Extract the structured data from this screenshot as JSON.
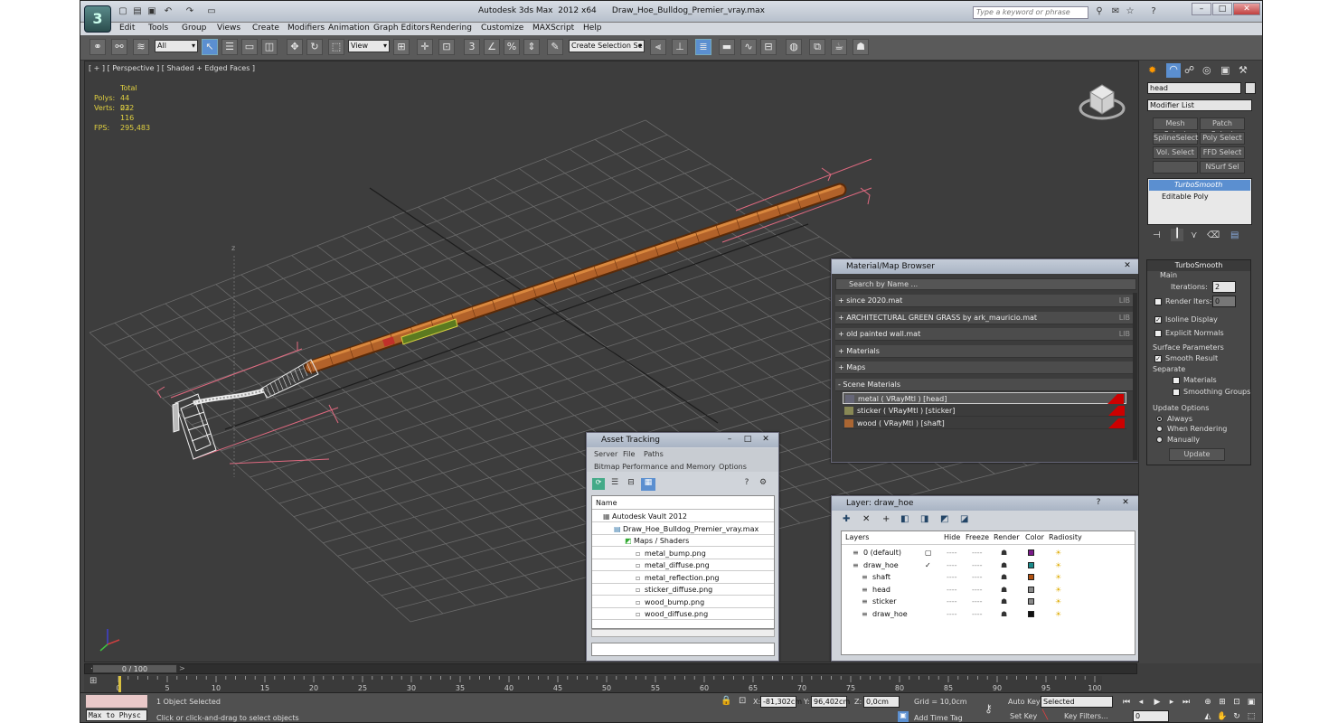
{
  "window": {
    "title": "Autodesk 3ds Max  2012 x64      Draw_Hoe_Bulldog_Premier_vray.max",
    "search_placeholder": "Type a keyword or phrase",
    "minimize": "–",
    "maximize": "□",
    "close": "✕"
  },
  "menu": [
    "Edit",
    "Tools",
    "Group",
    "Views",
    "Create",
    "Modifiers",
    "Animation",
    "Graph Editors",
    "Rendering",
    "Customize",
    "MAXScript",
    "Help"
  ],
  "toolbar": {
    "filter_value": "All",
    "refcoord_value": "View",
    "selection_set_placeholder": "Create Selection Se",
    "snap_label": "3",
    "angle_snap_label": "%"
  },
  "viewport": {
    "label": "[ + ] [ Perspective ] [ Shaded + Edged Faces ]",
    "stats_header": "Total",
    "polys_label": "Polys:",
    "polys_value": "44 032",
    "verts_label": "Verts:",
    "verts_value": "22 116",
    "fps_label": "FPS:",
    "fps_value": "295,483",
    "pivot_label": "z"
  },
  "command_panel": {
    "object_name": "head",
    "modifier_list": "Modifier List",
    "mod_buttons": [
      "Mesh Select",
      "Patch Select",
      "SplineSelect",
      "Poly Select",
      "Vol. Select",
      "FFD Select",
      "",
      "NSurf Sel"
    ],
    "stack": [
      "TurboSmooth",
      "Editable Poly"
    ],
    "rollout_title": "TurboSmooth",
    "main_label": "Main",
    "iterations_label": "Iterations:",
    "iterations_value": "2",
    "render_iters_label": "Render Iters:",
    "render_iters_value": "0",
    "isoline": "Isoline Display",
    "explicit_normals": "Explicit Normals",
    "surface_params": "Surface Parameters",
    "smooth_result": "Smooth Result",
    "separate": "Separate",
    "materials": "Materials",
    "smoothing_groups": "Smoothing Groups",
    "update_options": "Update Options",
    "always": "Always",
    "when_rendering": "When Rendering",
    "manually": "Manually",
    "update_button": "Update"
  },
  "material_browser": {
    "title": "Material/Map Browser",
    "search_placeholder": "Search by Name ...",
    "libraries": [
      "+ since 2020.mat",
      "+ ARCHITECTURAL GREEN GRASS by ark_mauricio.mat",
      "+ old painted wall.mat",
      "+ Materials",
      "+ Maps",
      "- Scene Materials"
    ],
    "lib_tag": "LIB",
    "scene_materials": [
      "metal  ( VRayMtl ) [head]",
      "sticker  ( VRayMtl ) [sticker]",
      "wood  ( VRayMtl ) [shaft]"
    ]
  },
  "asset_tracking": {
    "title": "Asset Tracking",
    "menu": [
      "Server",
      "File",
      "Paths"
    ],
    "menu2": [
      "Bitmap Performance and Memory",
      "Options"
    ],
    "column_name": "Name",
    "rows": [
      "Autodesk Vault 2012",
      "Draw_Hoe_Bulldog_Premier_vray.max",
      "Maps / Shaders",
      "metal_bump.png",
      "metal_diffuse.png",
      "metal_reflection.png",
      "sticker_diffuse.png",
      "wood_bump.png",
      "wood_diffuse.png"
    ]
  },
  "layer_panel": {
    "title": "Layer: draw_hoe",
    "help": "?",
    "columns": [
      "Layers",
      "Hide",
      "Freeze",
      "Render",
      "Color",
      "Radiosity"
    ],
    "rows": [
      {
        "name": "0 (default)",
        "color": "#7a1a8a"
      },
      {
        "name": "draw_hoe",
        "color": "#1a8a8a"
      },
      {
        "name": "shaft",
        "color": "#b05010"
      },
      {
        "name": "head",
        "color": "#8a8a8a"
      },
      {
        "name": "sticker",
        "color": "#8a8a8a"
      },
      {
        "name": "draw_hoe",
        "color": "#111111"
      }
    ]
  },
  "timeline": {
    "frame_display": "0 / 100",
    "ticks": [
      "0",
      "5",
      "10",
      "15",
      "20",
      "25",
      "30",
      "35",
      "40",
      "45",
      "50",
      "55",
      "60",
      "65",
      "70",
      "75",
      "80",
      "85",
      "90",
      "95",
      "100"
    ]
  },
  "status": {
    "maxscript": "Max to Physc",
    "selected": "1 Object Selected",
    "prompt": "Click or click-and-drag to select objects",
    "x_label": "X:",
    "x_value": "-81,302cm",
    "y_label": "Y:",
    "y_value": "96,402cm",
    "z_label": "Z:",
    "z_value": "0,0cm",
    "grid": "Grid = 10,0cm",
    "add_time_tag": "Add Time Tag",
    "auto_key": "Auto Key",
    "set_key": "Set Key",
    "selected_dd": "Selected",
    "key_filters": "Key Filters...",
    "frame_value": "0"
  }
}
